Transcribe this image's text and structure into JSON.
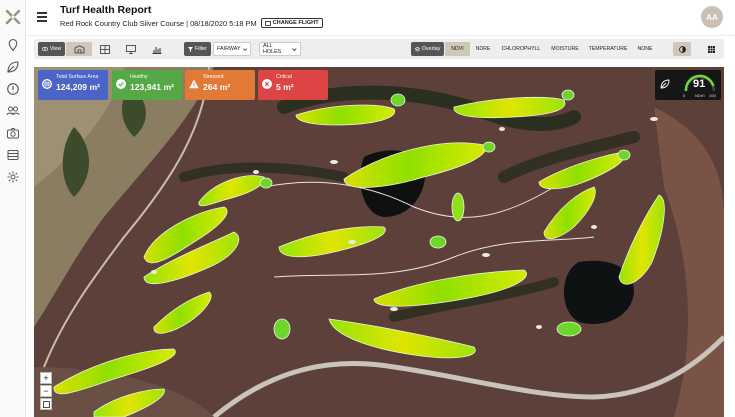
{
  "header": {
    "title": "Turf Health Report",
    "course": "Red Rock Country Club Silver Course | 08/18/2020 5:18 PM",
    "change_flight": "CHANGE FLIGHT",
    "avatar_initials": "AA"
  },
  "rail_icons": [
    "app-logo-icon",
    "map-pin-icon",
    "leaf-icon",
    "alert-icon",
    "group-icon",
    "camera-icon",
    "list-icon",
    "settings-icon"
  ],
  "toolbar": {
    "view_label": "View",
    "view_modes": [
      "map-view",
      "grid-view",
      "monitor-view",
      "chart-view"
    ],
    "selected_view": 0,
    "filter_label": "Filter",
    "area_value": "FAIRWAY",
    "holes_value": "ALL HOLES",
    "overlay_label": "Overlay",
    "overlays": [
      "NDVI",
      "NDRE",
      "CHLOROPHYLL",
      "MOISTURE",
      "TEMPERATURE",
      "NONE"
    ],
    "selected_overlay": "NDVI"
  },
  "cards": [
    {
      "label": "Total Surface Area",
      "value": "124,209 m²",
      "color": "#4a64c8",
      "icon": "globe-icon"
    },
    {
      "label": "Healthy",
      "value": "123,941 m²",
      "color": "#55a845",
      "icon": "check-circle-icon"
    },
    {
      "label": "Stressed",
      "value": "264 m²",
      "color": "#e07a36",
      "icon": "warning-icon"
    },
    {
      "label": "Critical",
      "value": "5 m²",
      "color": "#dd4545",
      "icon": "x-circle-icon"
    }
  ],
  "ndvi_gauge": {
    "value": "91",
    "label": "NDVI",
    "min": "0",
    "max": "100"
  },
  "zoom": {
    "in": "+",
    "out": "−"
  }
}
